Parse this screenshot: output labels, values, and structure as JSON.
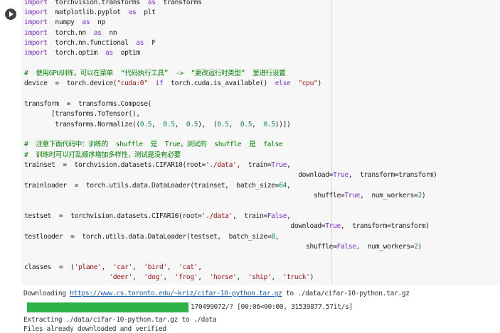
{
  "code_lines": [
    [
      {
        "t": "import",
        "c": "kw"
      },
      {
        "t": "  torchvision.transforms  ",
        "c": ""
      },
      {
        "t": "as",
        "c": "kw"
      },
      {
        "t": "  transforms",
        "c": ""
      }
    ],
    [
      {
        "t": "import",
        "c": "kw"
      },
      {
        "t": "  matplotlib.pyplot  ",
        "c": ""
      },
      {
        "t": "as",
        "c": "kw"
      },
      {
        "t": "  plt",
        "c": ""
      }
    ],
    [
      {
        "t": "import",
        "c": "kw"
      },
      {
        "t": "  numpy  ",
        "c": ""
      },
      {
        "t": "as",
        "c": "kw"
      },
      {
        "t": "  np",
        "c": ""
      }
    ],
    [
      {
        "t": "import",
        "c": "kw"
      },
      {
        "t": "  torch.nn  ",
        "c": ""
      },
      {
        "t": "as",
        "c": "kw"
      },
      {
        "t": "  nn",
        "c": ""
      }
    ],
    [
      {
        "t": "import",
        "c": "kw"
      },
      {
        "t": "  torch.nn.functional  ",
        "c": ""
      },
      {
        "t": "as",
        "c": "kw"
      },
      {
        "t": "  F",
        "c": ""
      }
    ],
    [
      {
        "t": "import",
        "c": "kw"
      },
      {
        "t": "  torch.optim  ",
        "c": ""
      },
      {
        "t": "as",
        "c": "kw"
      },
      {
        "t": "  optim",
        "c": ""
      }
    ],
    [],
    [
      {
        "t": "#  使用GPU训练，可以在菜单  “代码执行工具”  ->  “更改运行时类型”  里进行设置",
        "c": "cm"
      }
    ],
    [
      {
        "t": "device  =  torch.device(",
        "c": ""
      },
      {
        "t": "\"cuda:0\"",
        "c": "str"
      },
      {
        "t": "  ",
        "c": ""
      },
      {
        "t": "if",
        "c": "kw"
      },
      {
        "t": "  torch.cuda.is_available()  ",
        "c": ""
      },
      {
        "t": "else",
        "c": "kw"
      },
      {
        "t": "  ",
        "c": ""
      },
      {
        "t": "\"cpu\"",
        "c": "str"
      },
      {
        "t": ")",
        "c": ""
      }
    ],
    [],
    [
      {
        "t": "transform  =  transforms.Compose(",
        "c": ""
      }
    ],
    [
      {
        "t": "       [transforms.ToTensor(),",
        "c": ""
      }
    ],
    [
      {
        "t": "        transforms.Normalize((",
        "c": ""
      },
      {
        "t": "0.5",
        "c": "num"
      },
      {
        "t": ",  ",
        "c": ""
      },
      {
        "t": "0.5",
        "c": "num"
      },
      {
        "t": ",  ",
        "c": ""
      },
      {
        "t": "0.5",
        "c": "num"
      },
      {
        "t": "),  (",
        "c": ""
      },
      {
        "t": "0.5",
        "c": "num"
      },
      {
        "t": ",  ",
        "c": ""
      },
      {
        "t": "0.5",
        "c": "num"
      },
      {
        "t": ",  ",
        "c": ""
      },
      {
        "t": "0.5",
        "c": "num"
      },
      {
        "t": "))])",
        "c": ""
      }
    ],
    [],
    [
      {
        "t": "#  注意下面代码中：训练的  shuffle  是  True，测试的  shuffle  是  false",
        "c": "cm"
      }
    ],
    [
      {
        "t": "#  训练时可以打乱顺序增加多样性，测试是没有必要",
        "c": "cm"
      }
    ],
    [
      {
        "t": "trainset  =  torchvision.datasets.CIFAR10(root=",
        "c": ""
      },
      {
        "t": "'./data'",
        "c": "str"
      },
      {
        "t": ",  train=",
        "c": ""
      },
      {
        "t": "True",
        "c": "kw"
      },
      {
        "t": ",",
        "c": ""
      }
    ],
    [
      {
        "t": "                                                                       download=",
        "c": ""
      },
      {
        "t": "True",
        "c": "kw"
      },
      {
        "t": ",  transform=transform)",
        "c": ""
      }
    ],
    [
      {
        "t": "trainloader  =  torch.utils.data.DataLoader(trainset,  batch_size=",
        "c": ""
      },
      {
        "t": "64",
        "c": "num"
      },
      {
        "t": ",",
        "c": ""
      }
    ],
    [
      {
        "t": "                                                                           shuffle=",
        "c": ""
      },
      {
        "t": "True",
        "c": "kw"
      },
      {
        "t": ",  num_workers=",
        "c": ""
      },
      {
        "t": "2",
        "c": "num"
      },
      {
        "t": ")",
        "c": ""
      }
    ],
    [],
    [
      {
        "t": "testset  =  torchvision.datasets.CIFAR10(root=",
        "c": ""
      },
      {
        "t": "'./data'",
        "c": "str"
      },
      {
        "t": ",  train=",
        "c": ""
      },
      {
        "t": "False",
        "c": "kw"
      },
      {
        "t": ",",
        "c": ""
      }
    ],
    [
      {
        "t": "                                                                     download=",
        "c": ""
      },
      {
        "t": "True",
        "c": "kw"
      },
      {
        "t": ",  transform=transform)",
        "c": ""
      }
    ],
    [
      {
        "t": "testloader  =  torch.utils.data.DataLoader(testset,  batch_size=",
        "c": ""
      },
      {
        "t": "8",
        "c": "num"
      },
      {
        "t": ",",
        "c": ""
      }
    ],
    [
      {
        "t": "                                                                         shuffle=",
        "c": ""
      },
      {
        "t": "False",
        "c": "kw"
      },
      {
        "t": ",  num_workers=",
        "c": ""
      },
      {
        "t": "2",
        "c": "num"
      },
      {
        "t": ")",
        "c": ""
      }
    ],
    [],
    [
      {
        "t": "classes  =  (",
        "c": ""
      },
      {
        "t": "'plane'",
        "c": "str"
      },
      {
        "t": ",  ",
        "c": ""
      },
      {
        "t": "'car'",
        "c": "str"
      },
      {
        "t": ",  ",
        "c": ""
      },
      {
        "t": "'bird'",
        "c": "str"
      },
      {
        "t": ",  ",
        "c": ""
      },
      {
        "t": "'cat'",
        "c": "str"
      },
      {
        "t": ",",
        "c": ""
      }
    ],
    [
      {
        "t": "                      ",
        "c": ""
      },
      {
        "t": "'deer'",
        "c": "str"
      },
      {
        "t": ",  ",
        "c": ""
      },
      {
        "t": "'dog'",
        "c": "str"
      },
      {
        "t": ",  ",
        "c": ""
      },
      {
        "t": "'frog'",
        "c": "str"
      },
      {
        "t": ",  ",
        "c": ""
      },
      {
        "t": "'horse'",
        "c": "str"
      },
      {
        "t": ",  ",
        "c": ""
      },
      {
        "t": "'ship'",
        "c": "str"
      },
      {
        "t": ",  ",
        "c": ""
      },
      {
        "t": "'truck'",
        "c": "str"
      },
      {
        "t": ")",
        "c": ""
      }
    ]
  ],
  "output": {
    "downloading_prefix": "Downloading ",
    "download_url": "https://www.cs.toronto.edu/~kriz/cifar-10-python.tar.gz",
    "downloading_suffix": " to ./data/cifar-10-python.tar.gz",
    "progress_fraction": 1.0,
    "progress_text": "170499072/? [00:06<00:00, 31539877.57it/s]",
    "extracting": "Extracting ./data/cifar-10-python.tar.gz to ./data",
    "verified": "Files already downloaded and verified"
  },
  "colors": {
    "progress": "#2db24a",
    "editor_bg": "#f7f7f7",
    "keyword": "#7b30d0",
    "string": "#a31515",
    "comment": "#008000"
  },
  "icons": {
    "run": "play-circle-icon"
  }
}
